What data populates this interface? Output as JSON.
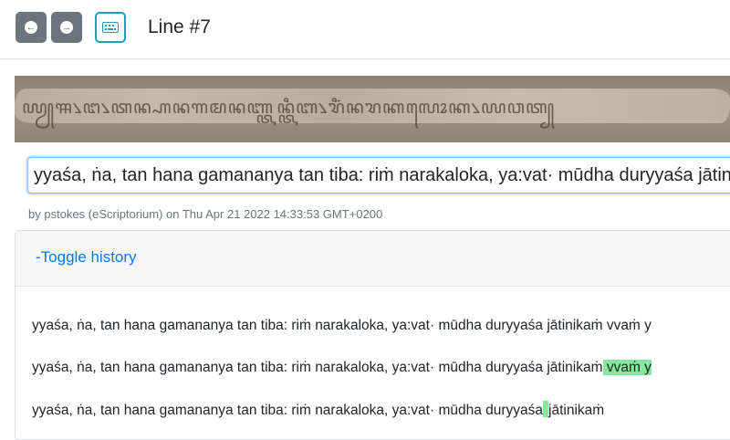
{
  "header": {
    "title": "Line #7",
    "prev_icon": "arrow-left-circle-icon",
    "next_icon": "arrow-right-circle-icon",
    "keyboard_icon": "keyboard-icon"
  },
  "manuscript": {
    "script_text": "ꦪꦾꦯ꧈ꦔ꧈ꦠꦤ꧀ꦲꦤꦒꦩꦤꦚ꧀ꦠꦤ꧀ꦠꦶꦧ꧈ꦫꦶꦁꦤꦫꦏꦭꦺꦴꦏ꧈ꦪꦮꦠ꧀"
  },
  "transcription": {
    "value": "yyaśa, ṅa, tan hana gamananya tan tiba: riṁ narakaloka, ya:vat· mūdha duryyaśa jātinikaṁ"
  },
  "meta": {
    "text": "by pstokes (eScriptorium) on Thu Apr 21 2022 14:33:53 GMT+0200"
  },
  "history": {
    "toggle_label": "-Toggle history",
    "lines": [
      {
        "text": "yyaśa, ṅa, tan hana gamananya tan tiba: riṁ narakaloka, ya:vat· mūdha duryyaśa jātinikaṁ vvaṁ y"
      },
      {
        "text": "yyaśa, ṅa, tan hana gamananya tan tiba: riṁ narakaloka, ya:vat· mūdha duryyaśa jātinikaṁ",
        "inserted": " vvaṁ y"
      },
      {
        "text_before": "yyaśa, ṅa, tan hana gamananya tan tiba: riṁ narakaloka, ya:vat· mūdha duryyaśa",
        "text_after": "jātinikaṁ"
      }
    ]
  },
  "colors": {
    "accent": "#17a2b8",
    "link": "#007bff",
    "diff_insert": "#85e89d"
  }
}
